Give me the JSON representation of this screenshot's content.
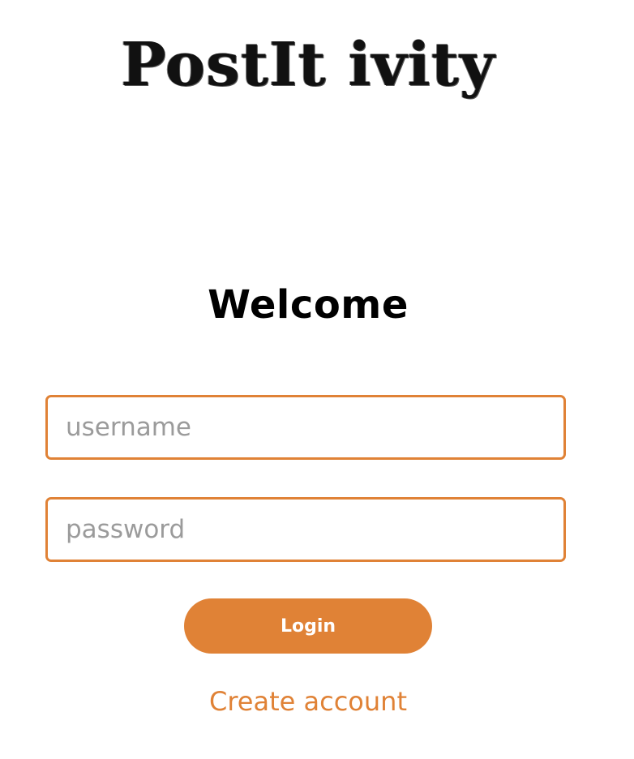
{
  "logo": {
    "text": "PostIt ivity"
  },
  "heading": {
    "title": "Welcome"
  },
  "form": {
    "username": {
      "placeholder": "username",
      "value": ""
    },
    "password": {
      "placeholder": "password",
      "value": ""
    },
    "login_label": "Login",
    "create_account_label": "Create account"
  },
  "colors": {
    "accent": "#E08236",
    "text": "#000000",
    "placeholder": "#9B9B9B",
    "background": "#FFFFFF"
  }
}
